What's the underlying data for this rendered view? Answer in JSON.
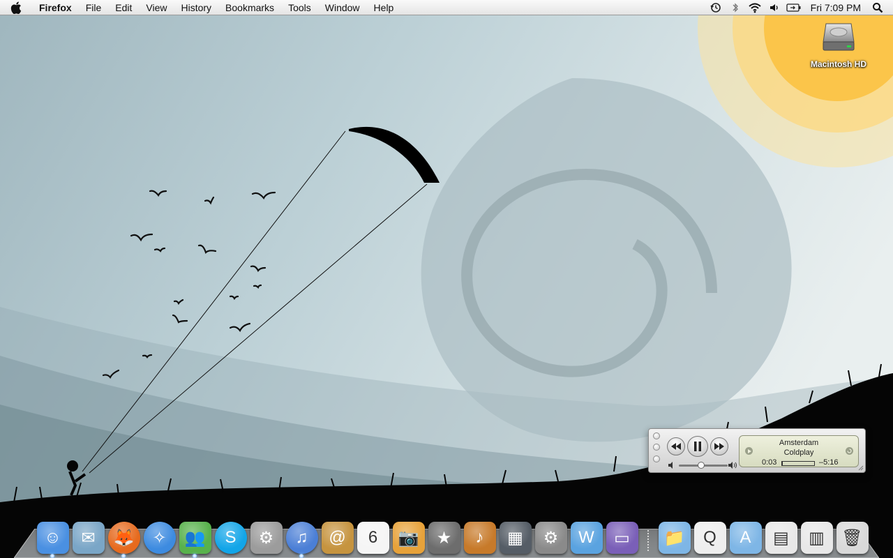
{
  "menubar": {
    "apple_icon": "apple-icon",
    "app_name": "Firefox",
    "menus": [
      "File",
      "Edit",
      "View",
      "History",
      "Bookmarks",
      "Tools",
      "Window",
      "Help"
    ],
    "status_icons": [
      "time-machine-icon",
      "bluetooth-icon",
      "wifi-icon",
      "volume-icon",
      "battery-icon"
    ],
    "clock": "Fri 7:09 PM",
    "spotlight_icon": "spotlight-icon"
  },
  "desktop": {
    "disk_label": "Macintosh HD"
  },
  "mini_player": {
    "song": "Amsterdam",
    "artist": "Coldplay",
    "elapsed": "0:03",
    "remaining": "–5:16",
    "progress_fraction": 0.01,
    "volume_fraction": 0.45,
    "state": "playing"
  },
  "dock": {
    "apps": [
      {
        "name": "finder",
        "glyph": "☺",
        "bg": "#4a90e2",
        "running": true
      },
      {
        "name": "mail",
        "glyph": "✉",
        "bg": "#7aa6c7",
        "running": false
      },
      {
        "name": "firefox",
        "glyph": "🦊",
        "bg": "#e66a1e",
        "running": true,
        "round": true
      },
      {
        "name": "safari",
        "glyph": "✧",
        "bg": "#3d8be0",
        "running": false,
        "round": true
      },
      {
        "name": "messenger",
        "glyph": "👥",
        "bg": "#58b24c",
        "running": true
      },
      {
        "name": "skype",
        "glyph": "S",
        "bg": "#12a5e8",
        "running": false,
        "round": true
      },
      {
        "name": "automator",
        "glyph": "⚙",
        "bg": "#9c9c9c",
        "running": false
      },
      {
        "name": "itunes",
        "glyph": "♫",
        "bg": "#4b7fd6",
        "running": true,
        "round": true
      },
      {
        "name": "address-book",
        "glyph": "@",
        "bg": "#c6943f",
        "running": false
      },
      {
        "name": "ical",
        "glyph": "6",
        "bg": "#f5f5f5",
        "running": false
      },
      {
        "name": "iphoto",
        "glyph": "📷",
        "bg": "#e7a23a",
        "running": false
      },
      {
        "name": "imovie",
        "glyph": "★",
        "bg": "#6d6d6d",
        "running": false
      },
      {
        "name": "garageband",
        "glyph": "♪",
        "bg": "#c77a2a",
        "running": false
      },
      {
        "name": "dashboard",
        "glyph": "▦",
        "bg": "#555d66",
        "running": false
      },
      {
        "name": "system-preferences",
        "glyph": "⚙",
        "bg": "#8a8a8a",
        "running": false
      },
      {
        "name": "word",
        "glyph": "W",
        "bg": "#5aa3e0",
        "running": false
      },
      {
        "name": "gba-emulator",
        "glyph": "▭",
        "bg": "#7a5fb8",
        "running": false
      }
    ],
    "stacks": [
      {
        "name": "documents-folder",
        "glyph": "📁",
        "bg": "#7eb6e6"
      },
      {
        "name": "mpeg-file",
        "glyph": "Q",
        "bg": "#eeeeee"
      },
      {
        "name": "applications-folder",
        "glyph": "A",
        "bg": "#7eb6e6"
      },
      {
        "name": "downloads-stack",
        "glyph": "▤",
        "bg": "#e8e8e8"
      },
      {
        "name": "firefox-download",
        "glyph": "▥",
        "bg": "#e8e8e8"
      }
    ],
    "trash": {
      "name": "trash",
      "glyph": "🗑",
      "bg": "#d9d9d9"
    }
  }
}
